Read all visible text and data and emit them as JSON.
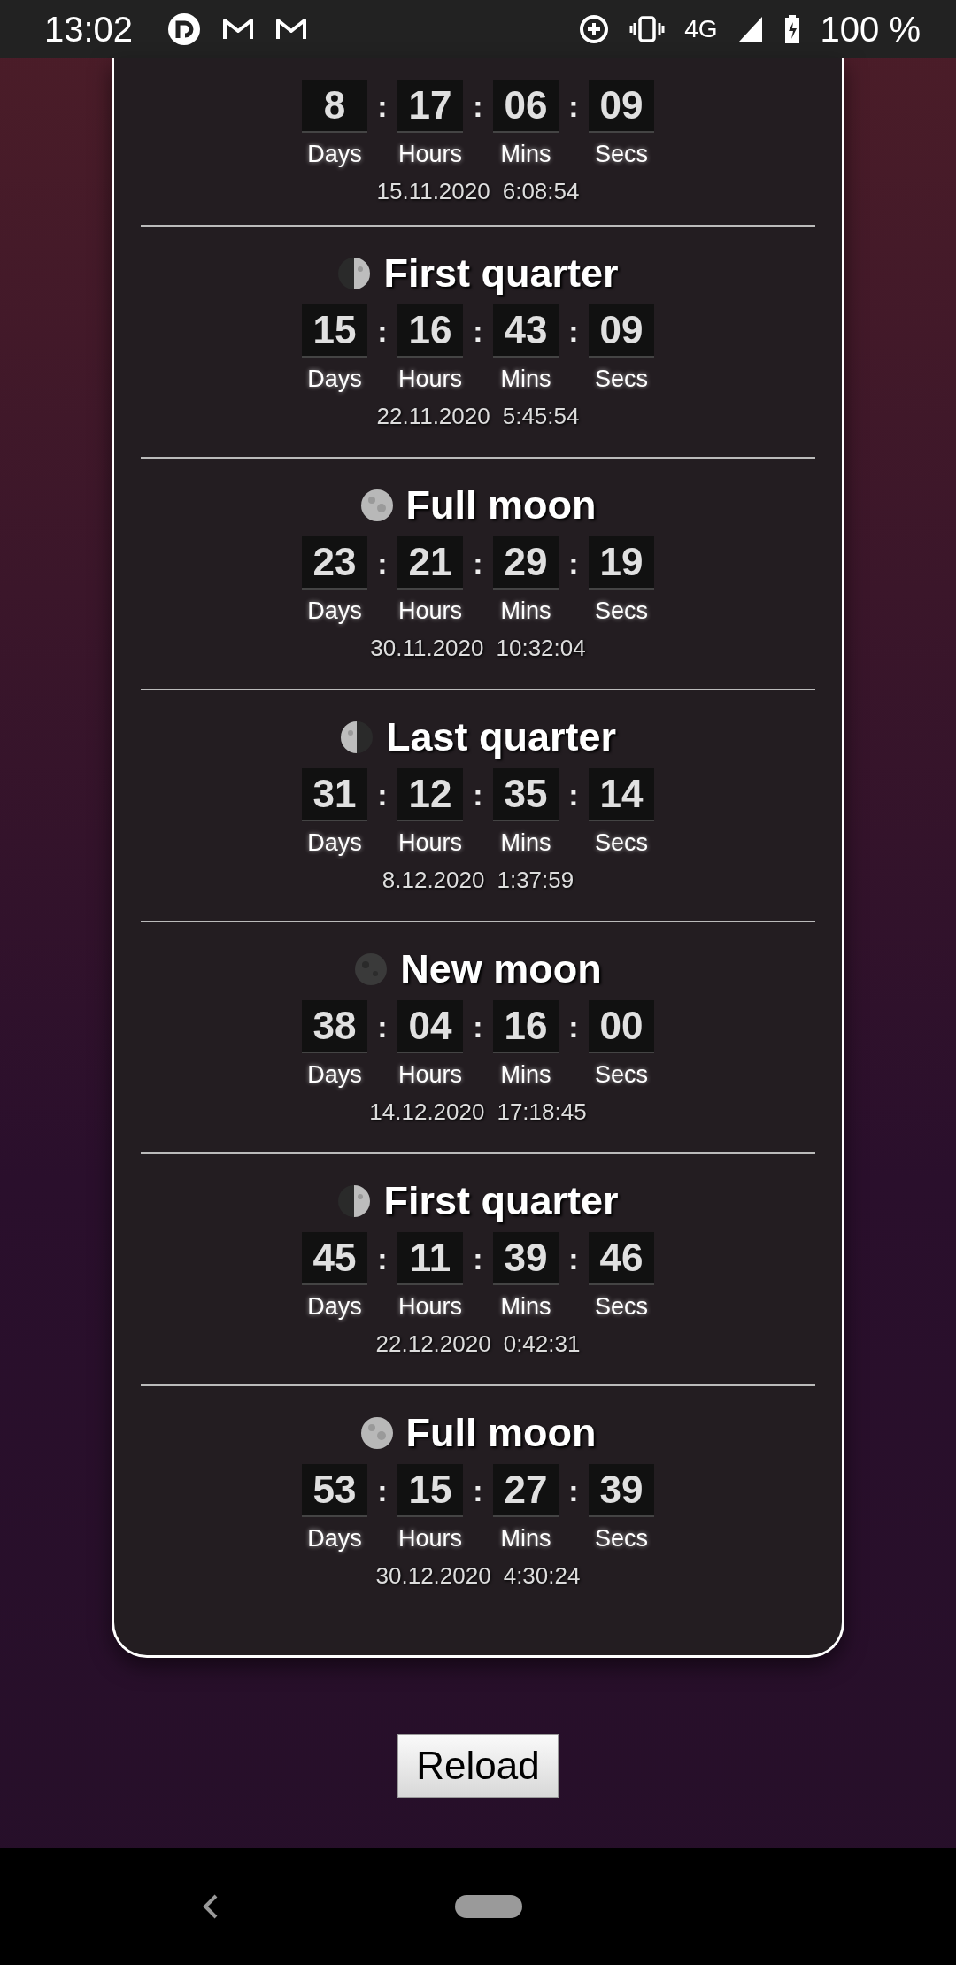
{
  "status_bar": {
    "time": "13:02",
    "network": "4G",
    "battery": "100 %"
  },
  "phases": [
    {
      "separators": [
        ":",
        ":",
        ":"
      ],
      "counter": [
        "8",
        "17",
        "06",
        "09"
      ],
      "units": [
        "Days",
        "Hours",
        "Mins",
        "Secs"
      ],
      "date": "15.11.2020",
      "time": "6:08:54"
    },
    {
      "kind": "first",
      "title": "First quarter",
      "separators": [
        ":",
        ":",
        ":"
      ],
      "counter": [
        "15",
        "16",
        "43",
        "09"
      ],
      "units": [
        "Days",
        "Hours",
        "Mins",
        "Secs"
      ],
      "date": "22.11.2020",
      "time": "5:45:54"
    },
    {
      "kind": "full",
      "title": "Full moon",
      "separators": [
        ":",
        ":",
        ":"
      ],
      "counter": [
        "23",
        "21",
        "29",
        "19"
      ],
      "units": [
        "Days",
        "Hours",
        "Mins",
        "Secs"
      ],
      "date": "30.11.2020",
      "time": "10:32:04"
    },
    {
      "kind": "last",
      "title": "Last quarter",
      "separators": [
        ":",
        ":",
        ":"
      ],
      "counter": [
        "31",
        "12",
        "35",
        "14"
      ],
      "units": [
        "Days",
        "Hours",
        "Mins",
        "Secs"
      ],
      "date": "8.12.2020",
      "time": "1:37:59"
    },
    {
      "kind": "new",
      "title": "New moon",
      "separators": [
        ":",
        ":",
        ":"
      ],
      "counter": [
        "38",
        "04",
        "16",
        "00"
      ],
      "units": [
        "Days",
        "Hours",
        "Mins",
        "Secs"
      ],
      "date": "14.12.2020",
      "time": "17:18:45"
    },
    {
      "kind": "first",
      "title": "First quarter",
      "separators": [
        ":",
        ":",
        ":"
      ],
      "counter": [
        "45",
        "11",
        "39",
        "46"
      ],
      "units": [
        "Days",
        "Hours",
        "Mins",
        "Secs"
      ],
      "date": "22.12.2020",
      "time": "0:42:31"
    },
    {
      "kind": "full",
      "title": "Full moon",
      "separators": [
        ":",
        ":",
        ":"
      ],
      "counter": [
        "53",
        "15",
        "27",
        "39"
      ],
      "units": [
        "Days",
        "Hours",
        "Mins",
        "Secs"
      ],
      "date": "30.12.2020",
      "time": "4:30:24"
    }
  ],
  "reload_button": "Reload"
}
